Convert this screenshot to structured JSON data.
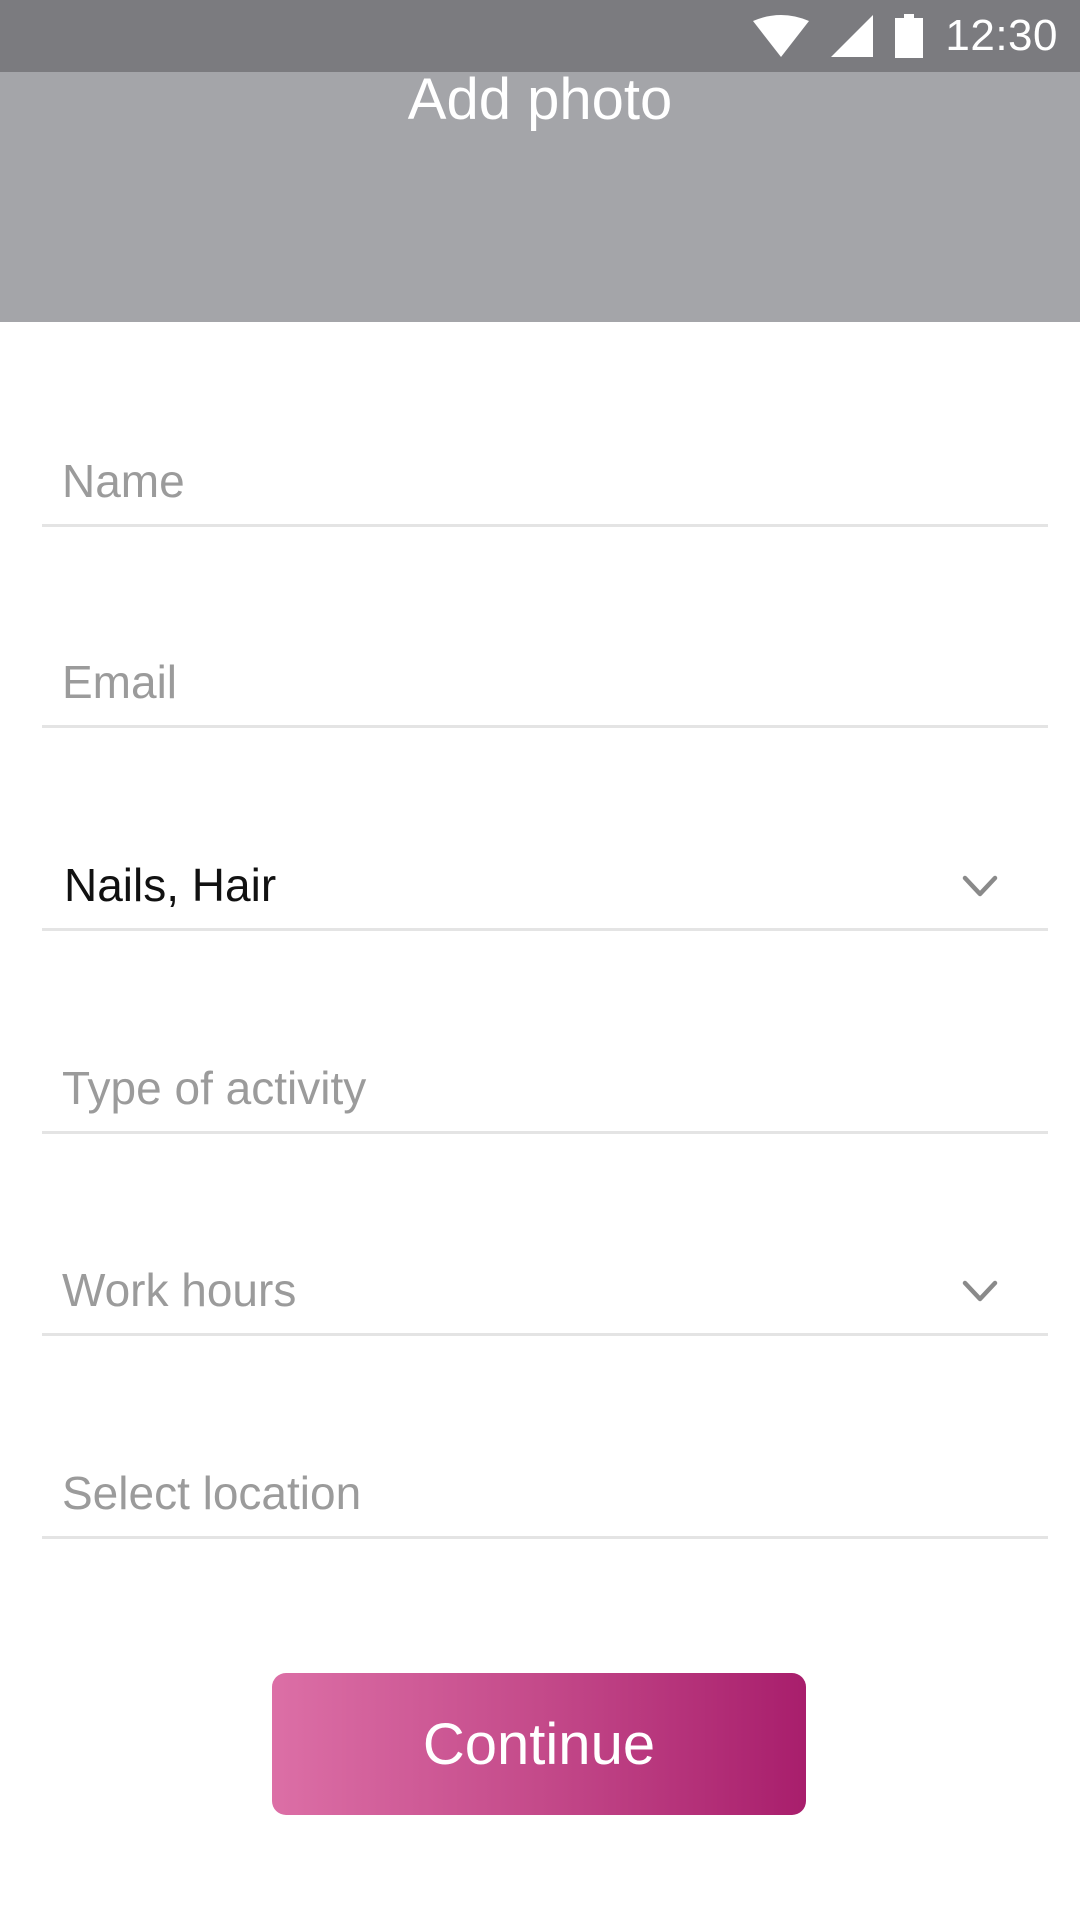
{
  "status_bar": {
    "time": "12:30",
    "icons": [
      "wifi-icon",
      "cellular-signal-icon",
      "battery-icon"
    ]
  },
  "photo": {
    "title": "Add photo"
  },
  "form": {
    "name_placeholder": "Name",
    "email_placeholder": "Email",
    "category_value": "Nails, Hair",
    "activity_placeholder": "Type of activity",
    "work_hours_placeholder": "Work hours",
    "location_placeholder": "Select location"
  },
  "actions": {
    "continue_label": "Continue"
  },
  "colors": {
    "status_bar_bg": "#7b7b7f",
    "photo_area_bg": "#a4a5a9",
    "placeholder_text": "#9b9b9b",
    "divider": "#e4e4e4",
    "button_gradient_start": "#dc6fa6",
    "button_gradient_end": "#a81e6c"
  }
}
